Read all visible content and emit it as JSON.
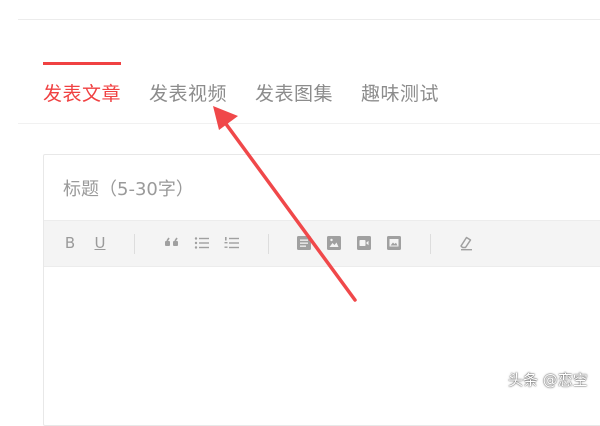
{
  "tabs": [
    {
      "label": "发表文章",
      "active": true
    },
    {
      "label": "发表视频",
      "active": false
    },
    {
      "label": "发表图集",
      "active": false
    },
    {
      "label": "趣味测试",
      "active": false
    }
  ],
  "editor": {
    "title_placeholder": "标题（5-30字）",
    "toolbar": {
      "bold_label": "B",
      "underline_label": "U",
      "icons": [
        "quote-icon",
        "bulleted-list-icon",
        "numbered-list-icon",
        "paragraph-icon",
        "image-icon",
        "video-icon",
        "gallery-icon",
        "clear-format-icon"
      ]
    }
  },
  "watermark": "头条 @恋空",
  "colors": {
    "accent": "#f04142",
    "toolbar_bg": "#f4f4f4",
    "icon": "#999999",
    "arrow": "#f0484a"
  }
}
